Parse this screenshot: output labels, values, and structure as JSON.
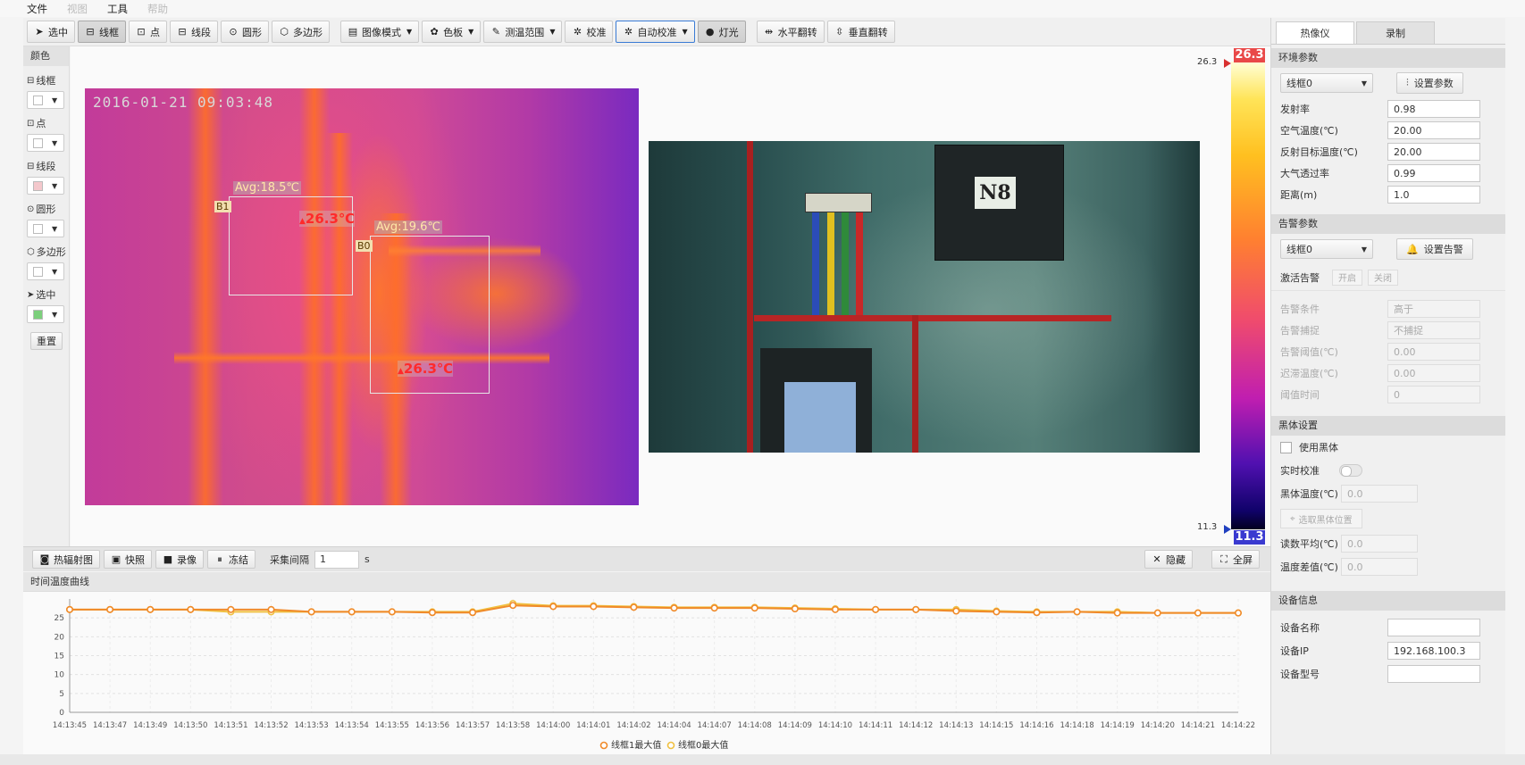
{
  "menu": {
    "items": [
      "文件",
      "视图",
      "工具",
      "帮助"
    ]
  },
  "toolbar": {
    "select": "选中",
    "lineframe": "线框",
    "point": "点",
    "segment": "线段",
    "circle": "圆形",
    "polygon": "多边形",
    "image_mode": "图像模式",
    "palette": "色板",
    "temp_range": "测温范围",
    "calibrate": "校准",
    "auto_calibrate": "自动校准",
    "light": "灯光",
    "hflip": "水平翻转",
    "vflip": "垂直翻转"
  },
  "left_panel": {
    "header": "颜色",
    "items": [
      {
        "label": "线框",
        "color": "#ffffff"
      },
      {
        "label": "点",
        "color": "#ffffff"
      },
      {
        "label": "线段",
        "color": "#f4c8cc"
      },
      {
        "label": "圆形",
        "color": "#ffffff"
      },
      {
        "label": "多边形",
        "color": "#ffffff"
      },
      {
        "label": "选中",
        "color": "#7ccf7c"
      }
    ],
    "reset": "重置"
  },
  "thermal": {
    "timestamp": "2016-01-21 09:03:48",
    "roi": [
      {
        "id": "B1",
        "avg": "Avg:18.5℃",
        "max": "26.3℃"
      },
      {
        "id": "B0",
        "avg": "Avg:19.6℃",
        "max": "26.3℃"
      }
    ]
  },
  "visible": {
    "label": "N8"
  },
  "colorbar": {
    "max_label": "26.3",
    "min_label": "11.3",
    "max_tick": "26.3",
    "min_tick": "11.3"
  },
  "bottombar": {
    "thermal_map": "热辐射图",
    "snapshot": "快照",
    "record": "录像",
    "freeze": "冻结",
    "interval_label": "采集间隔",
    "interval_value": "1",
    "interval_unit": "s",
    "hide": "隐藏",
    "fullscreen": "全屏"
  },
  "chart_data": {
    "type": "line",
    "title": "时间温度曲线",
    "x": [
      "14:13:45",
      "14:13:47",
      "14:13:49",
      "14:13:50",
      "14:13:51",
      "14:13:52",
      "14:13:53",
      "14:13:54",
      "14:13:55",
      "14:13:56",
      "14:13:57",
      "14:13:58",
      "14:14:00",
      "14:14:01",
      "14:14:02",
      "14:14:04",
      "14:14:07",
      "14:14:08",
      "14:14:09",
      "14:14:10",
      "14:14:11",
      "14:14:12",
      "14:14:13",
      "14:14:15",
      "14:14:16",
      "14:14:18",
      "14:14:19",
      "14:14:20",
      "14:14:21",
      "14:14:22"
    ],
    "yticks": [
      0,
      5,
      10,
      15,
      20,
      25
    ],
    "ylim": [
      0,
      30
    ],
    "series": [
      {
        "name": "线框1最大值",
        "color": "#f08a2a",
        "values": [
          27.2,
          27.2,
          27.2,
          27.2,
          27.2,
          27.2,
          26.6,
          26.6,
          26.6,
          26.4,
          26.4,
          28.3,
          28.0,
          28.0,
          27.8,
          27.6,
          27.6,
          27.6,
          27.4,
          27.2,
          27.2,
          27.2,
          26.8,
          26.6,
          26.4,
          26.6,
          26.3,
          26.3,
          26.3,
          26.3
        ]
      },
      {
        "name": "线框0最大值",
        "color": "#f0c040",
        "values": [
          27.2,
          27.2,
          27.2,
          27.2,
          26.6,
          26.6,
          26.6,
          26.6,
          26.6,
          26.6,
          26.6,
          28.8,
          28.2,
          28.2,
          28.0,
          27.8,
          27.8,
          27.8,
          27.6,
          27.4,
          27.2,
          27.2,
          27.2,
          26.8,
          26.6,
          26.6,
          26.6,
          26.3,
          26.3,
          26.3
        ]
      }
    ]
  },
  "right_panel": {
    "tabs": [
      "热像仪",
      "录制"
    ],
    "env": {
      "title": "环境参数",
      "selector": "线框0",
      "set_button": "设置参数",
      "fields": [
        {
          "label": "发射率",
          "value": "0.98"
        },
        {
          "label": "空气温度(℃)",
          "value": "20.00"
        },
        {
          "label": "反射目标温度(℃)",
          "value": "20.00"
        },
        {
          "label": "大气透过率",
          "value": "0.99"
        },
        {
          "label": "距离(m)",
          "value": "1.0"
        }
      ]
    },
    "alarm": {
      "title": "告警参数",
      "selector": "线框0",
      "set_button": "设置告警",
      "activate_label": "激活告警",
      "on": "开启",
      "off": "关闭",
      "fields": [
        {
          "label": "告警条件",
          "value": "高于"
        },
        {
          "label": "告警捕捉",
          "value": "不捕捉"
        },
        {
          "label": "告警阈值(℃)",
          "value": "0.00"
        },
        {
          "label": "迟滞温度(℃)",
          "value": "0.00"
        },
        {
          "label": "阈值时间",
          "value": "0"
        }
      ]
    },
    "blackbody": {
      "title": "黑体设置",
      "use_label": "使用黑体",
      "realtime_label": "实时校准",
      "temp_label": "黑体温度(℃)",
      "temp_value": "0.0",
      "pick_button": "选取黑体位置",
      "avg_label": "读数平均(℃)",
      "avg_value": "0.0",
      "diff_label": "温度差值(℃)",
      "diff_value": "0.0"
    },
    "device": {
      "title": "设备信息",
      "name_label": "设备名称",
      "name_value": "",
      "ip_label": "设备IP",
      "ip_value": "192.168.100.3",
      "model_label": "设备型号",
      "model_value": ""
    }
  }
}
